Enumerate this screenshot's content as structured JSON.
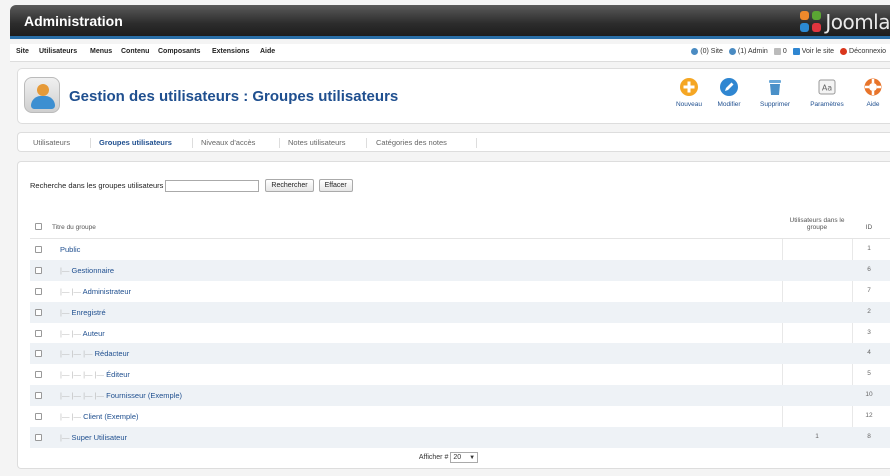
{
  "header": {
    "title": "Administration",
    "brand": "Joomla",
    "accent": "#2a6fa8"
  },
  "menu": {
    "items": [
      "Site",
      "Utilisateurs",
      "Menus",
      "Contenu",
      "Composants",
      "Extensions",
      "Aide"
    ],
    "status": {
      "site": "(0) Site",
      "admin": "(1) Admin",
      "messages": "0",
      "view_site": "Voir le site",
      "logout": "Déconnexio"
    }
  },
  "toolbar": {
    "page_title": "Gestion des utilisateurs : Groupes utilisateurs",
    "buttons": [
      {
        "label": "Nouveau",
        "icon": "plus-icon",
        "color": "#f5a623"
      },
      {
        "label": "Modifier",
        "icon": "pencil-icon",
        "color": "#2f86d1"
      },
      {
        "label": "Supprimer",
        "icon": "trash-icon",
        "color": "#4a90c8"
      },
      {
        "label": "Paramètres",
        "icon": "settings-icon",
        "color": "#888888"
      },
      {
        "label": "Aide",
        "icon": "lifebuoy-icon",
        "color": "#e8742a"
      }
    ]
  },
  "tabs": [
    "Utilisateurs",
    "Groupes utilisateurs",
    "Niveaux d'accès",
    "Notes utilisateurs",
    "Catégories des notes"
  ],
  "active_tab": "Groupes utilisateurs",
  "search": {
    "label": "Recherche dans les groupes utilisateurs",
    "value": "",
    "search_button": "Rechercher",
    "clear_button": "Effacer"
  },
  "table": {
    "headers": {
      "title": "Titre du groupe",
      "users": "Utilisateurs dans le groupe",
      "id": "ID"
    },
    "rows": [
      {
        "level": 0,
        "title": "Public",
        "users": "",
        "id": "1"
      },
      {
        "level": 1,
        "title": "Gestionnaire",
        "users": "",
        "id": "6"
      },
      {
        "level": 2,
        "title": "Administrateur",
        "users": "",
        "id": "7"
      },
      {
        "level": 1,
        "title": "Enregistré",
        "users": "",
        "id": "2"
      },
      {
        "level": 2,
        "title": "Auteur",
        "users": "",
        "id": "3"
      },
      {
        "level": 3,
        "title": "Rédacteur",
        "users": "",
        "id": "4"
      },
      {
        "level": 4,
        "title": "Éditeur",
        "users": "",
        "id": "5"
      },
      {
        "level": 4,
        "title": "Fournisseur (Exemple)",
        "users": "",
        "id": "10"
      },
      {
        "level": 2,
        "title": "Client (Exemple)",
        "users": "",
        "id": "12"
      },
      {
        "level": 1,
        "title": "Super Utilisateur",
        "users": "1",
        "id": "8"
      }
    ]
  },
  "pagination": {
    "label": "Afficher #",
    "value": "20"
  }
}
